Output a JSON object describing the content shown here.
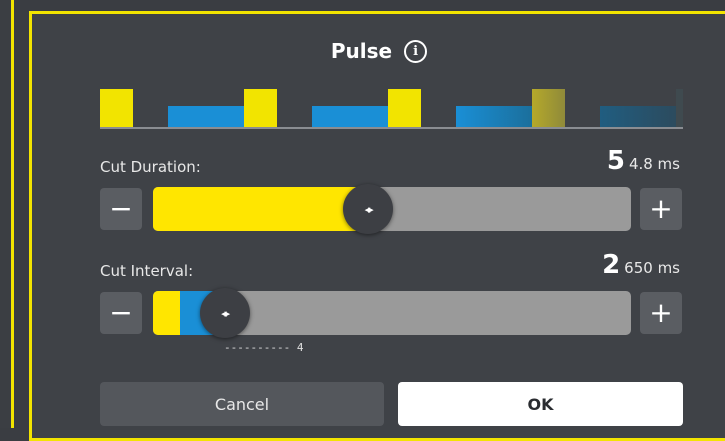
{
  "dialog": {
    "title": "Pulse",
    "info_icon_glyph": "i"
  },
  "preview": {
    "pulse_color": "#f2e400",
    "interval_color": "#1a8fd6",
    "baseline_color": "#8a8d92"
  },
  "cut_duration": {
    "label": "Cut Duration:",
    "value_major": "5",
    "value_detail": "4.8 ms",
    "minus": "−",
    "plus": "+",
    "fill_fraction": 0.45,
    "fill_color": "#ffe600"
  },
  "cut_interval": {
    "label": "Cut Interval:",
    "value_major": "2",
    "value_detail": "650 ms",
    "minus": "−",
    "plus": "+",
    "fill_fraction": 0.15,
    "pulse_color": "#ffe600",
    "interval_color": "#1a8fd6",
    "tick_text": "---------- 4"
  },
  "thumb_glyph": "◂▸",
  "buttons": {
    "cancel": "Cancel",
    "ok": "OK"
  }
}
